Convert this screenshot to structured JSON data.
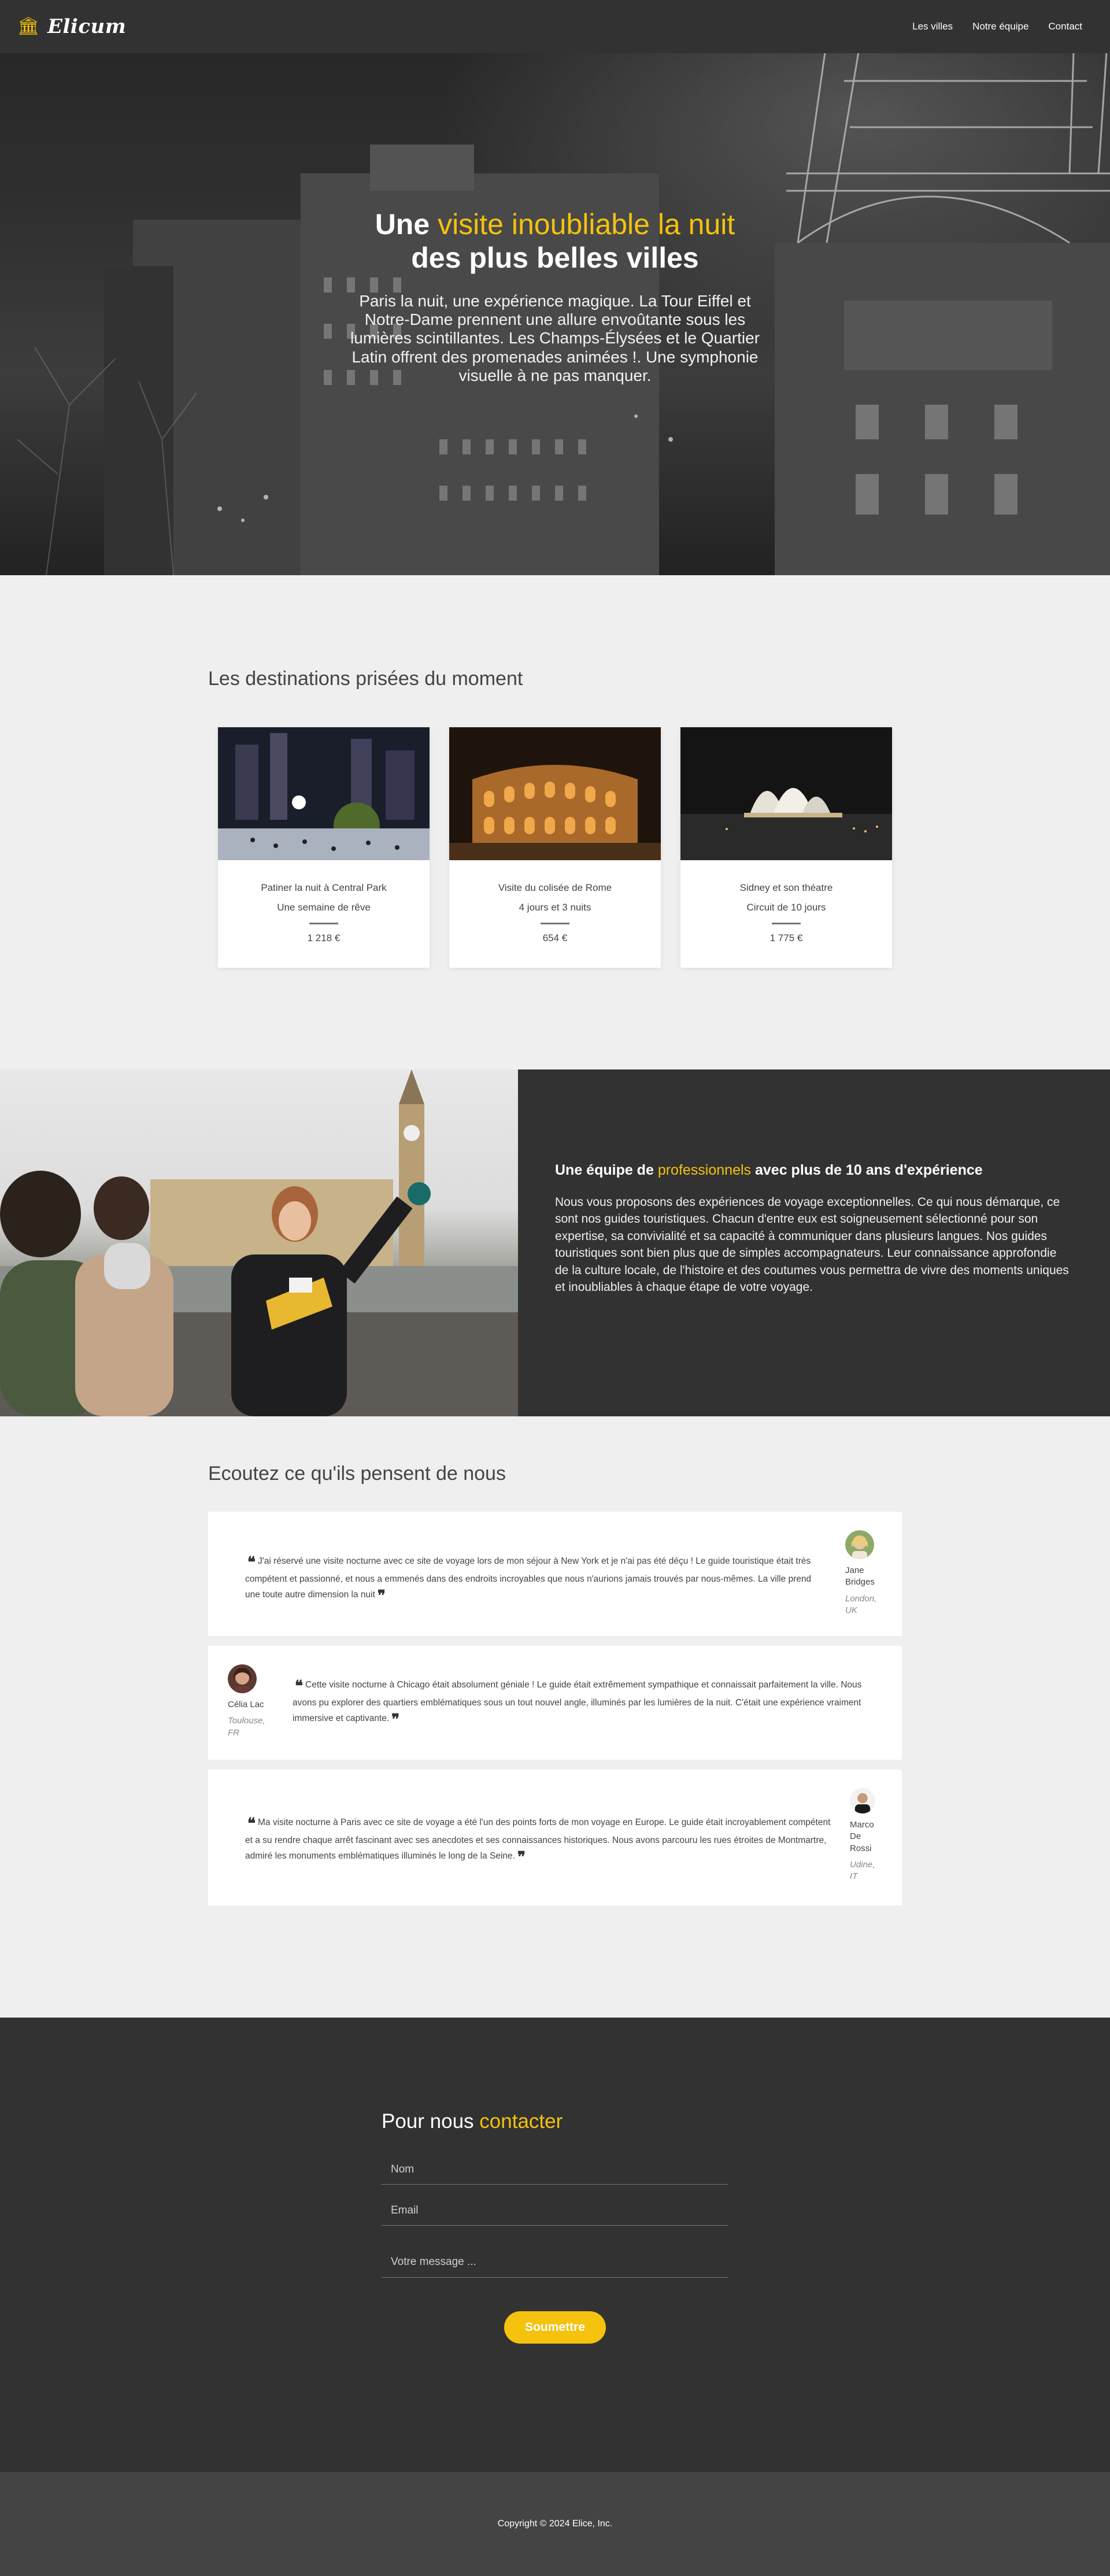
{
  "nav": {
    "brand_icon": "museum-icon",
    "brand": "Elicum",
    "links": [
      "Les villes",
      "Notre équipe",
      "Contact"
    ]
  },
  "hero": {
    "title_start": "Une",
    "title_accent": "visite inoubliable la nuit",
    "title_end": "des plus belles villes",
    "description": "Paris la nuit, une expérience magique. La Tour Eiffel et Notre-Dame prennent une allure envoûtante sous les lumières scintillantes. Les Champs-Élysées et le Quartier Latin offrent des promenades animées !. Une symphonie visuelle à ne pas manquer."
  },
  "destinations": {
    "title": "Les destinations prisées du moment",
    "cards": [
      {
        "title": "Patiner la nuit à Central Park",
        "subtitle": "Une semaine de rêve",
        "price": "1 218 €"
      },
      {
        "title": "Visite du colisée de Rome",
        "subtitle": "4 jours et 3 nuits",
        "price": "654 €"
      },
      {
        "title": "Sidney et son théatre",
        "subtitle": "Circuit de 10 jours",
        "price": "1 775 €"
      }
    ]
  },
  "team": {
    "title_start": "Une équipe de",
    "title_accent": "professionnels",
    "title_end": "avec plus de 10 ans d'expérience",
    "description": "Nous vous proposons des expériences de voyage exceptionnelles. Ce qui nous démarque, ce sont nos guides touristiques. Chacun d'entre eux est soigneusement sélectionné pour son expertise, sa convivialité et sa capacité à communiquer dans plusieurs langues. Nos guides touristiques sont bien plus que de simples accompagnateurs. Leur connaissance approfondie de la culture locale, de l'histoire et des coutumes vous permettra de vivre des moments uniques et inoubliables à chaque étape de votre voyage."
  },
  "testimonials": {
    "title": "Ecoutez ce qu'ils pensent de nous",
    "items": [
      {
        "quote": "J'ai réservé une visite nocturne avec ce site de voyage lors de mon séjour à New York et je n'ai pas été déçu ! Le guide touristique était très compétent et passionné, et nous a emmenés dans des endroits incroyables que nous n'aurions jamais trouvés par nous-mêmes. La ville prend une toute autre dimension la nuit",
        "name": "Jane Bridges",
        "location": "London, UK"
      },
      {
        "quote": "Cette visite nocturne à Chicago était absolument géniale ! Le guide était extrêmement sympathique et connaissait parfaitement la ville. Nous avons pu explorer des quartiers emblématiques sous un tout nouvel angle, illuminés par les lumières de la nuit. C'était une expérience vraiment immersive et captivante.",
        "name": "Célia Lac",
        "location": "Toulouse, FR"
      },
      {
        "quote": "Ma visite nocturne à Paris avec ce site de voyage a été l'un des points forts de mon voyage en Europe. Le guide était incroyablement compétent et a su rendre chaque arrêt fascinant avec ses anecdotes et ses connaissances historiques. Nous avons parcouru les rues étroites de Montmartre, admiré les monuments emblématiques illuminés le long de la Seine.",
        "name": "Marco De Rossi",
        "location": "Udine, IT"
      }
    ]
  },
  "contact": {
    "title_start": "Pour nous",
    "title_accent": "contacter",
    "name_placeholder": "Nom",
    "email_placeholder": "Email",
    "message_placeholder": "Votre message ...",
    "submit_label": "Soumettre"
  },
  "footer": {
    "copyright": "Copyright © 2024 Elice, Inc."
  },
  "colors": {
    "accent": "#f5c20d",
    "dark": "#323232",
    "footer": "#444444",
    "background": "#efefef"
  }
}
